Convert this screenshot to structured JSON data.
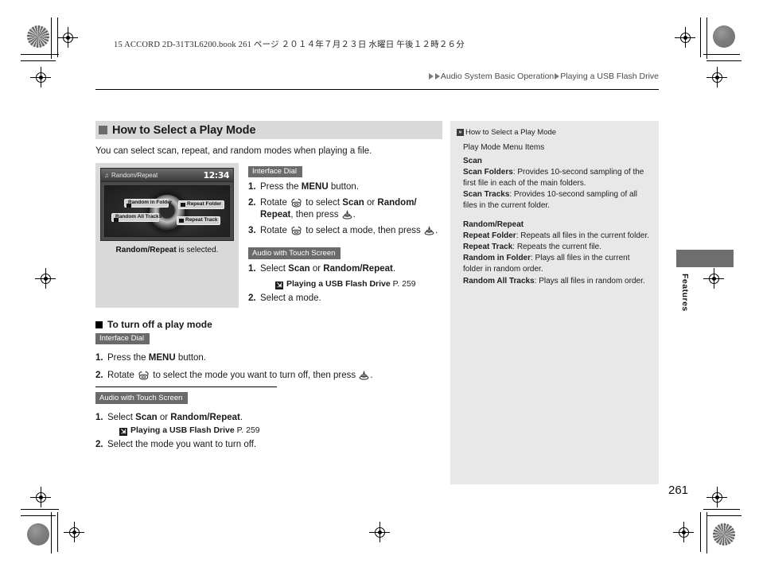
{
  "print_info": {
    "file_line": "15 ACCORD 2D-31T3L6200.book   261 ページ   ２０１４年７月２３日   水曜日   午後１２時２６分"
  },
  "breadcrumb": {
    "level1": "Audio System Basic Operation",
    "level2": "Playing a USB Flash Drive"
  },
  "main": {
    "section_title": "How to Select a Play Mode",
    "intro": "You can select scan, repeat, and random modes when playing a file.",
    "illustration": {
      "screen_title": "Random/Repeat",
      "clock": "12:34",
      "options": [
        "Random in Folder",
        "Random All Tracks",
        "Repeat Folder",
        "Repeat Track"
      ],
      "caption_bold": "Random/Repeat",
      "caption_rest": " is selected."
    },
    "interface_dial_tag": "Interface Dial",
    "dial_steps": [
      {
        "num": "1.",
        "pre": "Press the ",
        "bold": "MENU",
        "post": " button."
      },
      {
        "num": "2.",
        "pre": "Rotate ",
        "bold": "",
        "post": ""
      },
      {
        "num": "3.",
        "pre": "Rotate ",
        "bold": "",
        "post": ""
      }
    ],
    "step2_parts": {
      "a": "Rotate ",
      "b": " to select ",
      "c": "Scan",
      "d": " or ",
      "e": "Random/",
      "f": "Repeat",
      "g": ", then press ",
      "h": "."
    },
    "step3_parts": {
      "a": "Rotate ",
      "b": " to select a mode, then press ",
      "c": "."
    },
    "touch_tag": "Audio with Touch Screen",
    "touch_steps": {
      "s1_pre": "Select ",
      "s1_b1": "Scan",
      "s1_mid": " or ",
      "s1_b2": "Random/Repeat",
      "s1_post": ".",
      "ref_bold": "Playing a USB Flash Drive",
      "ref_page": " P. 259",
      "s2": "Select a mode."
    }
  },
  "turn_off": {
    "title": "To turn off a play mode",
    "interface_dial_tag": "Interface Dial",
    "step1_pre": "Press the ",
    "step1_bold": "MENU",
    "step1_post": " button.",
    "step2_a": "Rotate ",
    "step2_b": " to select the mode you want to turn off, then press ",
    "step2_c": ".",
    "touch_tag": "Audio with Touch Screen",
    "t_s1_pre": "Select ",
    "t_s1_b1": "Scan",
    "t_s1_mid": " or ",
    "t_s1_b2": "Random/Repeat",
    "t_s1_post": ".",
    "ref_bold": "Playing a USB Flash Drive",
    "ref_page": " P. 259",
    "t_s2": "Select the mode you want to turn off."
  },
  "sidebar": {
    "head": "How to Select a Play Mode",
    "subhead": "Play Mode Menu Items",
    "scan_title": "Scan",
    "scan_folders_b": "Scan Folders",
    "scan_folders_t": ": Provides 10-second sampling of the first file in each of the main folders.",
    "scan_tracks_b": "Scan Tracks",
    "scan_tracks_t": ": Provides 10-second sampling of all files in the current folder.",
    "rr_title": "Random/Repeat",
    "repeat_folder_b": "Repeat Folder",
    "repeat_folder_t": ": Repeats all files in the current folder.",
    "repeat_track_b": "Repeat Track",
    "repeat_track_t": ": Repeats the current file.",
    "random_folder_b": "Random in Folder",
    "random_folder_t": ": Plays all files in the current folder in random order.",
    "random_all_b": "Random All Tracks",
    "random_all_t": ": Plays all files in random order."
  },
  "tab": {
    "label": "Features"
  },
  "page_number": "261",
  "colors": {
    "section_head_bg": "#d9d9d9",
    "sidebar_bg": "#e8e8e8",
    "tag_bg": "#6b6b6b",
    "tab_bg": "#6e6e6e"
  }
}
